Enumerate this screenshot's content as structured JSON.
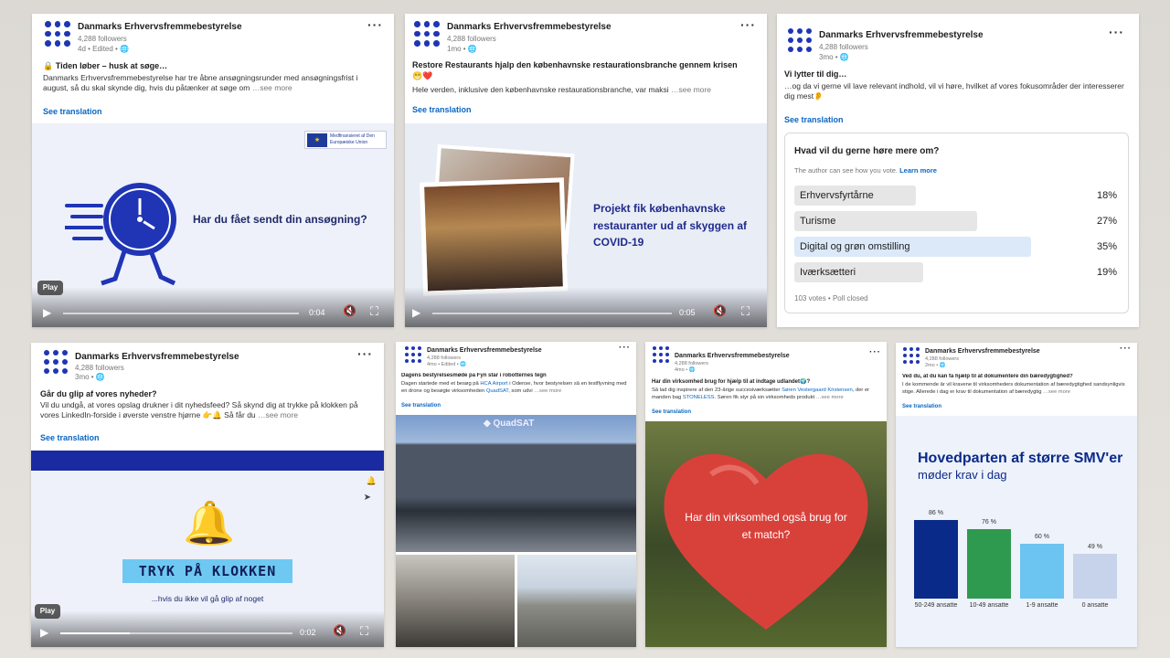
{
  "org": {
    "name": "Danmarks Erhvervsfremmebestyrelse",
    "followers": "4,288 followers",
    "brand_color": "#1f35b5"
  },
  "posts": [
    {
      "meta": "4d • Edited • ",
      "title": "Tiden løber – husk at søge…",
      "title_emoji": "🔒",
      "body": "Danmarks Erhvervsfremmebestyrelse har tre åbne ansøgningsrunder med ansøgningsfrist i august, så du skal skynde dig, hvis du påtænker at søge om",
      "see_more": "…see more",
      "translate": "See translation",
      "eu_label": "Medfinansieret af Den Europæiske Union",
      "media_text": "Har du fået sendt din ansøgning?",
      "play": "Play",
      "time": "0:04",
      "progress": 0.0
    },
    {
      "meta": "1mo • ",
      "title": "Restore Restaurants hjalp den københavnske restaurationsbranche gennem krisen",
      "emojis": "😁❤️",
      "body": "Hele verden, inklusive den københavnske restaurationsbranche, var maksi",
      "see_more": "…see more",
      "translate": "See translation",
      "media_text": "Projekt fik københavnske restauranter ud af skyggen af COVID-19",
      "time": "0:05",
      "progress": 0.0
    },
    {
      "meta": "3mo • ",
      "title": "Vi lytter til dig…",
      "body": "…og da vi gerne vil lave relevant indhold, vil vi høre, hvilket af vores fokusområder der interesserer dig mest👂",
      "translate": "See translation",
      "poll": {
        "question": "Hvad vil du gerne høre mere om?",
        "note": "The author can see how you vote.",
        "learn_more": "Learn more",
        "options": [
          {
            "label": "Erhvervsfyrtårne",
            "pct": "18%",
            "value": 18,
            "selected": false
          },
          {
            "label": "Turisme",
            "pct": "27%",
            "value": 27,
            "selected": false
          },
          {
            "label": "Digital og grøn omstilling",
            "pct": "35%",
            "value": 35,
            "selected": true
          },
          {
            "label": "Iværksætteri",
            "pct": "19%",
            "value": 19,
            "selected": false
          }
        ],
        "footer": "103 votes • Poll closed"
      }
    },
    {
      "meta": "3mo • ",
      "title": "Går du glip af vores nyheder?",
      "body": "Vil du undgå, at vores opslag drukner i dit nyhedsfeed? Så skynd dig at trykke på klokken på vores LinkedIn-forside i øverste venstre hjørne 👉🔔 Så får du",
      "see_more": "…see more",
      "translate": "See translation",
      "media_title": "TRYK PÅ KLOKKEN",
      "media_sub": "...hvis du ikke vil gå glip af noget",
      "play": "Play",
      "time": "0:02",
      "progress": 0.3
    },
    {
      "meta": "4mo • Edited • ",
      "title": "Dagens bestyrelsesmøde på Fyn står i robotternes tegn",
      "body_pre": "Dagen startede med et besøg på ",
      "body_link1": "HCA Airport",
      "body_mid": " i Odense, hvor bestyrelsen så en testflyvning med en drone og besøgte virksomheden ",
      "body_link2": "QuadSAT",
      "body_post": ", som udvi",
      "see_more": "…see more",
      "translate": "See translation",
      "sign": "QuadSAT"
    },
    {
      "meta": "4mo • ",
      "title": "Har din virksomhed brug for hjælp til at indtage udlandet🌍?",
      "body_pre": "Så lad dig inspirere af den 23-årige succesiværksætter ",
      "body_link1": "Søren Vestergaard Kristensen",
      "body_mid": ", der er manden bag ",
      "body_link2": "STONELESS",
      "body_post": ". Søren fik styr på sin virksomheds produkt",
      "see_more": "…see more",
      "translate": "See translation",
      "media_text": "Har din virksomhed også brug for et match?"
    },
    {
      "meta": "2mo • ",
      "title": "Ved du, at du kan få hjælp til at dokumentere din bæredygtighed?",
      "body": "I de kommende år vil kravene til virksomheders dokumentation af bæredygtighed sandsynligvis stige. Allerede i dag er krav til dokumentation af bæredygtig",
      "see_more": "…see more",
      "translate": "See translation"
    }
  ],
  "chart_data": {
    "type": "bar",
    "title": "Hovedparten af større SMV'er",
    "subtitle": "møder krav i dag",
    "categories": [
      "50-249 ansatte",
      "10-49 ansatte",
      "1-9 ansatte",
      "0 ansatte"
    ],
    "values": [
      86,
      76,
      60,
      49
    ],
    "value_labels": [
      "86 %",
      "76 %",
      "60 %",
      "49 %"
    ],
    "colors": [
      "#0a2a8a",
      "#2e9a4f",
      "#6cc4f0",
      "#c7d3ea"
    ],
    "ylim": [
      0,
      100
    ]
  }
}
